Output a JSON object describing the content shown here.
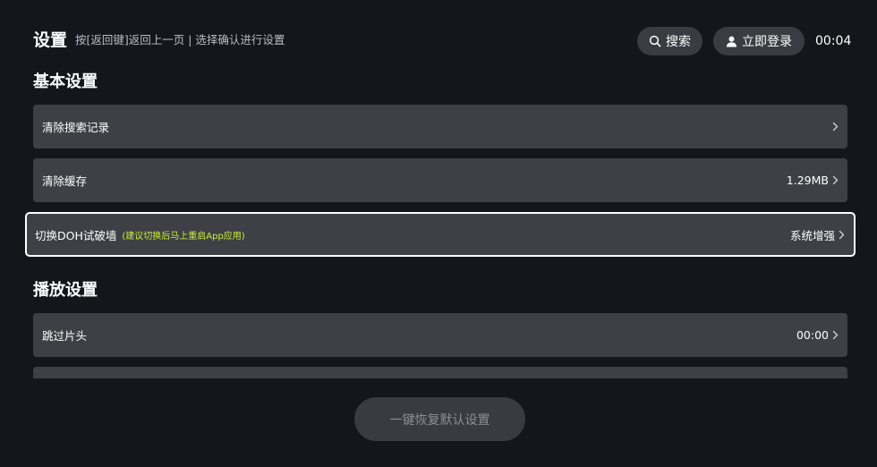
{
  "header": {
    "title": "设置",
    "hint": "按[返回键]返回上一页 | 选择确认进行设置",
    "search_label": "搜索",
    "search_icon": "search-icon",
    "login_label": "立即登录",
    "login_icon": "user-icon",
    "clock": "00:04"
  },
  "sections": {
    "basic": {
      "title": "基本设置",
      "items": [
        {
          "label": "清除搜索记录",
          "value": ""
        },
        {
          "label": "清除缓存",
          "value": "1.29MB"
        },
        {
          "label": "切换DOH试破墙",
          "sublabel": "(建议切换后马上重启App应用)",
          "value": "系统增强"
        }
      ]
    },
    "playback": {
      "title": "播放设置",
      "items": [
        {
          "label": "跳过片头",
          "value": "00:00"
        }
      ]
    }
  },
  "footer": {
    "reset_label": "一键恢复默认设置"
  },
  "colors": {
    "background": "#14161b",
    "row": "#3f4046",
    "pill": "#3a3c42",
    "accent_sublabel": "#c9ef3a",
    "focus_border": "#ffffff",
    "muted_text": "#8d8f96"
  }
}
